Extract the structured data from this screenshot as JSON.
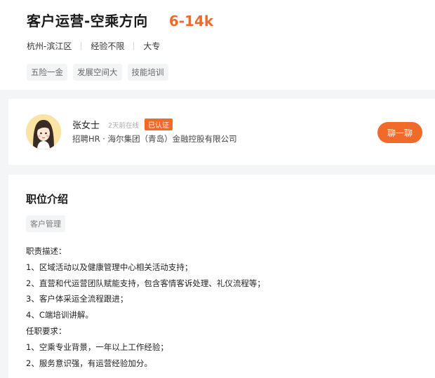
{
  "job": {
    "title": "客户运营-空乘方向",
    "salary": "6-14k",
    "meta": [
      "杭州-滨江区",
      "经验不限",
      "大专"
    ],
    "tags": [
      "五险一金",
      "发展空间大",
      "技能培训"
    ]
  },
  "recruiter": {
    "name": "张女士",
    "status": "2天前在线",
    "badge": "已认证",
    "company": "招聘HR · 海尔集团（青岛）金融控股有限公司",
    "chat_label": "聊一聊"
  },
  "description": {
    "section_title": "职位介绍",
    "category_tag": "客户管理",
    "lines": [
      "职责描述：",
      "1、区域活动以及健康管理中心相关活动支持；",
      "2、直营和代运营团队赋能支持，包含客情客诉处理、礼仪流程等；",
      "3、客户体采运全流程跟进；",
      "4、C端培训讲解。",
      "任职要求：",
      "1、空乘专业背景，一年以上工作经验；",
      "2、服务意识强，有运营经验加分。"
    ]
  },
  "colors": {
    "accent": "#f06a2a",
    "background": "#f4f5f7",
    "tag_bg": "#f3f4f6"
  }
}
